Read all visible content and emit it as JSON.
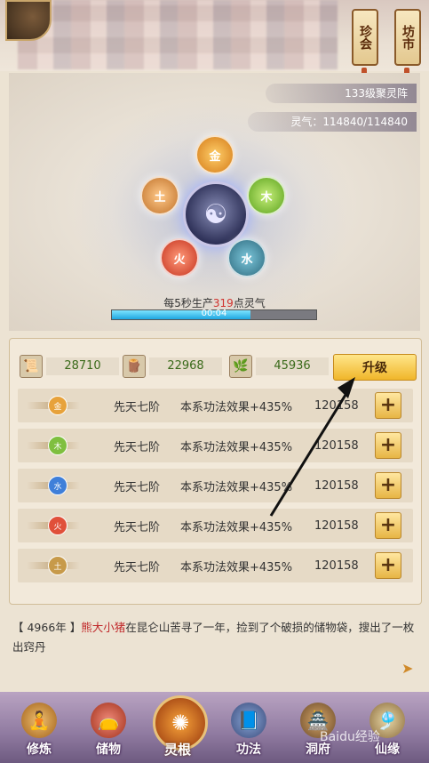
{
  "header": {
    "right_buttons": [
      {
        "label": "珍会"
      },
      {
        "label": "坊市"
      }
    ]
  },
  "formation": {
    "level_label": "133级聚灵阵",
    "spirit_label": "灵气：114840/114840",
    "elements": [
      "金",
      "木",
      "水",
      "火",
      "土"
    ],
    "produce_prefix": "每5秒生产",
    "produce_amount": "319",
    "produce_suffix": "点灵气",
    "timer": "00:04",
    "progress": 0.68
  },
  "resources": [
    {
      "icon": "scroll-icon",
      "value": "28710"
    },
    {
      "icon": "wood-icon",
      "value": "22968"
    },
    {
      "icon": "herb-icon",
      "value": "45936"
    }
  ],
  "upgrade_label": "升级",
  "items": [
    {
      "element": "金",
      "color": "#e7a23b",
      "level": "先天七阶",
      "effect": "本系功法效果+435%",
      "cost": "120158"
    },
    {
      "element": "木",
      "color": "#7fbf3f",
      "level": "先天七阶",
      "effect": "本系功法效果+435%",
      "cost": "120158"
    },
    {
      "element": "水",
      "color": "#3f7fd9",
      "level": "先天七阶",
      "effect": "本系功法效果+435%",
      "cost": "120158"
    },
    {
      "element": "火",
      "color": "#e0503a",
      "level": "先天七阶",
      "effect": "本系功法效果+435%",
      "cost": "120158"
    },
    {
      "element": "土",
      "color": "#c79a4a",
      "level": "先天七阶",
      "effect": "本系功法效果+435%",
      "cost": "120158"
    }
  ],
  "log": {
    "year": "【 4966年 】",
    "name": "熊大小猪",
    "text": "在昆仑山苦寻了一年，捡到了个破损的储物袋，搜出了一枚出窍丹"
  },
  "bottom_nav": [
    {
      "label": "修炼"
    },
    {
      "label": "储物"
    },
    {
      "label": "灵根"
    },
    {
      "label": "功法"
    },
    {
      "label": "洞府"
    },
    {
      "label": "仙缘"
    }
  ],
  "watermark": "Baidu经验"
}
